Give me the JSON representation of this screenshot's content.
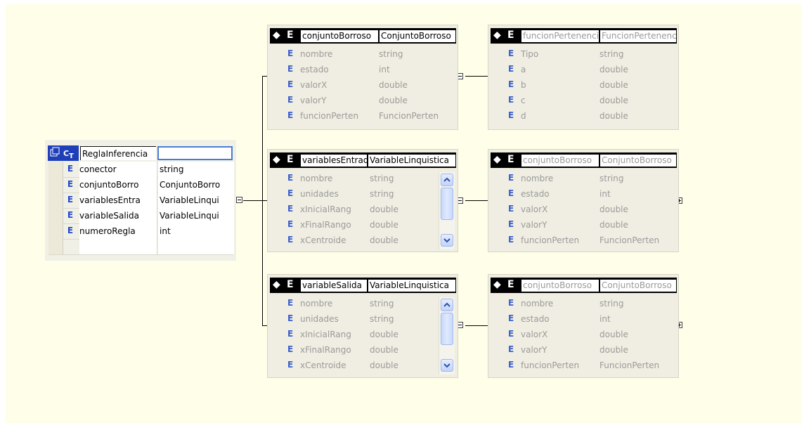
{
  "root": {
    "name": "ReglaInferencia",
    "type": "",
    "rows": [
      {
        "name": "conector",
        "type": "string"
      },
      {
        "name": "conjuntoBorro",
        "type": "ConjuntoBorro"
      },
      {
        "name": "variablesEntra",
        "type": "VariableLinqui"
      },
      {
        "name": "variableSalida",
        "type": "VariableLinqui"
      },
      {
        "name": "numeroRegla",
        "type": "int"
      },
      {
        "name": "",
        "type": ""
      }
    ]
  },
  "entities": {
    "e1": {
      "name": "conjuntoBorroso",
      "type": "ConjuntoBorroso",
      "rows": [
        {
          "name": "nombre",
          "type": "string"
        },
        {
          "name": "estado",
          "type": "int"
        },
        {
          "name": "valorX",
          "type": "double"
        },
        {
          "name": "valorY",
          "type": "double"
        },
        {
          "name": "funcionPerten",
          "type": "FuncionPerten"
        }
      ]
    },
    "e2": {
      "name": "funcionPertenencia",
      "type": "FuncionPertenencia",
      "rows": [
        {
          "name": "Tipo",
          "type": "string"
        },
        {
          "name": "a",
          "type": "double"
        },
        {
          "name": "b",
          "type": "double"
        },
        {
          "name": "c",
          "type": "double"
        },
        {
          "name": "d",
          "type": "double"
        }
      ]
    },
    "e3": {
      "name": "variablesEntrada",
      "type": "VariableLinquistica",
      "rows": [
        {
          "name": "nombre",
          "type": "string"
        },
        {
          "name": "unidades",
          "type": "string"
        },
        {
          "name": "xInicialRang",
          "type": "double"
        },
        {
          "name": "xFinalRango",
          "type": "double"
        },
        {
          "name": "xCentroide",
          "type": "double"
        }
      ]
    },
    "e4": {
      "name": "conjuntoBorroso",
      "type": "ConjuntoBorroso",
      "rows": [
        {
          "name": "nombre",
          "type": "string"
        },
        {
          "name": "estado",
          "type": "int"
        },
        {
          "name": "valorX",
          "type": "double"
        },
        {
          "name": "valorY",
          "type": "double"
        },
        {
          "name": "funcionPerten",
          "type": "FuncionPerten"
        }
      ]
    },
    "e5": {
      "name": "variableSalida",
      "type": "VariableLinquistica",
      "rows": [
        {
          "name": "nombre",
          "type": "string"
        },
        {
          "name": "unidades",
          "type": "string"
        },
        {
          "name": "xInicialRang",
          "type": "double"
        },
        {
          "name": "xFinalRango",
          "type": "double"
        },
        {
          "name": "xCentroide",
          "type": "double"
        }
      ]
    },
    "e6": {
      "name": "conjuntoBorroso",
      "type": "ConjuntoBorroso",
      "rows": [
        {
          "name": "nombre",
          "type": "string"
        },
        {
          "name": "estado",
          "type": "int"
        },
        {
          "name": "valorX",
          "type": "double"
        },
        {
          "name": "valorY",
          "type": "double"
        },
        {
          "name": "funcionPerten",
          "type": "FuncionPerten"
        }
      ]
    }
  },
  "labels": {
    "element_badge": "E",
    "complex_type_badge": "CT",
    "global_badge": "◆"
  },
  "icons": [
    "table-icon",
    "complex-type-icon",
    "element-icon",
    "global-element-icon",
    "collapse-icon",
    "expand-icon",
    "scroll-up-icon",
    "scroll-down-icon"
  ],
  "colors": {
    "canvas": "#ffffe9",
    "box": "#f0eee2",
    "accent": "#2448c8",
    "header": "#000000",
    "selection": "#4b7bd4"
  }
}
